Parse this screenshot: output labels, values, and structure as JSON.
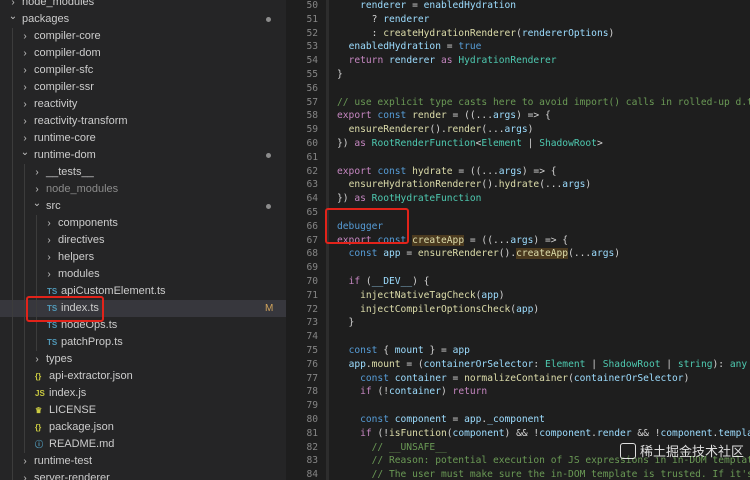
{
  "sidebar": {
    "items": [
      {
        "label": "node_modules",
        "kind": "folder",
        "depth": 0,
        "open": false,
        "dot": false
      },
      {
        "label": "packages",
        "kind": "folder",
        "depth": 0,
        "open": true,
        "dot": true
      },
      {
        "label": "compiler-core",
        "kind": "folder",
        "depth": 1,
        "open": false,
        "dot": false
      },
      {
        "label": "compiler-dom",
        "kind": "folder",
        "depth": 1,
        "open": false,
        "dot": false
      },
      {
        "label": "compiler-sfc",
        "kind": "folder",
        "depth": 1,
        "open": false,
        "dot": false
      },
      {
        "label": "compiler-ssr",
        "kind": "folder",
        "depth": 1,
        "open": false,
        "dot": false
      },
      {
        "label": "reactivity",
        "kind": "folder",
        "depth": 1,
        "open": false,
        "dot": false
      },
      {
        "label": "reactivity-transform",
        "kind": "folder",
        "depth": 1,
        "open": false,
        "dot": false
      },
      {
        "label": "runtime-core",
        "kind": "folder",
        "depth": 1,
        "open": false,
        "dot": false
      },
      {
        "label": "runtime-dom",
        "kind": "folder",
        "depth": 1,
        "open": true,
        "dot": true
      },
      {
        "label": "__tests__",
        "kind": "folder",
        "depth": 2,
        "open": false,
        "dot": false
      },
      {
        "label": "node_modules",
        "kind": "folder",
        "depth": 2,
        "open": false,
        "dot": false,
        "dim": true
      },
      {
        "label": "src",
        "kind": "folder",
        "depth": 2,
        "open": true,
        "dot": true
      },
      {
        "label": "components",
        "kind": "folder",
        "depth": 3,
        "open": false,
        "dot": false
      },
      {
        "label": "directives",
        "kind": "folder",
        "depth": 3,
        "open": false,
        "dot": false
      },
      {
        "label": "helpers",
        "kind": "folder",
        "depth": 3,
        "open": false,
        "dot": false
      },
      {
        "label": "modules",
        "kind": "folder",
        "depth": 3,
        "open": false,
        "dot": false
      },
      {
        "label": "apiCustomElement.ts",
        "kind": "ts",
        "depth": 3,
        "dot": false
      },
      {
        "label": "index.ts",
        "kind": "ts",
        "depth": 3,
        "dot": false,
        "modified": "M",
        "selected": true
      },
      {
        "label": "nodeOps.ts",
        "kind": "ts",
        "depth": 3,
        "dot": false
      },
      {
        "label": "patchProp.ts",
        "kind": "ts",
        "depth": 3,
        "dot": false
      },
      {
        "label": "types",
        "kind": "folder",
        "depth": 2,
        "open": false,
        "dot": false
      },
      {
        "label": "api-extractor.json",
        "kind": "json",
        "depth": 2,
        "dot": false
      },
      {
        "label": "index.js",
        "kind": "js",
        "depth": 2,
        "dot": false
      },
      {
        "label": "LICENSE",
        "kind": "license",
        "depth": 2,
        "dot": false
      },
      {
        "label": "package.json",
        "kind": "json",
        "depth": 2,
        "dot": false
      },
      {
        "label": "README.md",
        "kind": "md",
        "depth": 2,
        "dot": false
      },
      {
        "label": "runtime-test",
        "kind": "folder",
        "depth": 1,
        "open": false,
        "dot": false
      },
      {
        "label": "server-renderer",
        "kind": "folder",
        "depth": 1,
        "open": false,
        "dot": false
      }
    ]
  },
  "icons": {
    "ts": "TS",
    "json": "{}",
    "js": "JS",
    "license": "♛",
    "md": "ⓘ"
  },
  "colors": {
    "ts": "#519aba",
    "json": "#cbcb41",
    "js": "#cbcb41",
    "license": "#cbcb41",
    "md": "#519aba",
    "accent": "#e2231a"
  },
  "editor": {
    "lines": [
      {
        "n": "50",
        "tokens": [
          [
            "    ",
            "p"
          ],
          [
            "renderer",
            "v"
          ],
          [
            " = ",
            "p"
          ],
          [
            "enabledHydration",
            "v"
          ]
        ]
      },
      {
        "n": "51",
        "tokens": [
          [
            "      ? ",
            "p"
          ],
          [
            "renderer",
            "v"
          ]
        ]
      },
      {
        "n": "52",
        "tokens": [
          [
            "      : ",
            "p"
          ],
          [
            "createHydrationRenderer",
            "fn"
          ],
          [
            "(",
            "p"
          ],
          [
            "rendererOptions",
            "v"
          ],
          [
            ")",
            "p"
          ]
        ]
      },
      {
        "n": "53",
        "tokens": [
          [
            "  ",
            "p"
          ],
          [
            "enabledHydration",
            "v"
          ],
          [
            " = ",
            "p"
          ],
          [
            "true",
            "k"
          ]
        ]
      },
      {
        "n": "54",
        "tokens": [
          [
            "  ",
            "p"
          ],
          [
            "return",
            "kc"
          ],
          [
            " ",
            "p"
          ],
          [
            "renderer",
            "v"
          ],
          [
            " ",
            "p"
          ],
          [
            "as",
            "kc"
          ],
          [
            " ",
            "p"
          ],
          [
            "HydrationRenderer",
            "ty"
          ]
        ]
      },
      {
        "n": "55",
        "tokens": [
          [
            "}",
            "p"
          ]
        ]
      },
      {
        "n": "56",
        "tokens": []
      },
      {
        "n": "57",
        "tokens": [
          [
            "// use explicit type casts here to avoid import() calls in rolled-up d.ts",
            "cm"
          ]
        ]
      },
      {
        "n": "58",
        "tokens": [
          [
            "export",
            "kc"
          ],
          [
            " ",
            "p"
          ],
          [
            "const",
            "k"
          ],
          [
            " ",
            "p"
          ],
          [
            "render",
            "fn"
          ],
          [
            " = ((...",
            "p"
          ],
          [
            "args",
            "v"
          ],
          [
            ") => {",
            "p"
          ]
        ]
      },
      {
        "n": "59",
        "tokens": [
          [
            "  ",
            "p"
          ],
          [
            "ensureRenderer",
            "fn"
          ],
          [
            "().",
            "p"
          ],
          [
            "render",
            "fn"
          ],
          [
            "(...",
            "p"
          ],
          [
            "args",
            "v"
          ],
          [
            ")",
            "p"
          ]
        ]
      },
      {
        "n": "60",
        "tokens": [
          [
            "}) ",
            "p"
          ],
          [
            "as",
            "kc"
          ],
          [
            " ",
            "p"
          ],
          [
            "RootRenderFunction",
            "ty"
          ],
          [
            "<",
            "p"
          ],
          [
            "Element",
            "ty"
          ],
          [
            " | ",
            "p"
          ],
          [
            "ShadowRoot",
            "ty"
          ],
          [
            ">",
            "p"
          ]
        ]
      },
      {
        "n": "61",
        "tokens": []
      },
      {
        "n": "62",
        "tokens": [
          [
            "export",
            "kc"
          ],
          [
            " ",
            "p"
          ],
          [
            "const",
            "k"
          ],
          [
            " ",
            "p"
          ],
          [
            "hydrate",
            "fn"
          ],
          [
            " = ((...",
            "p"
          ],
          [
            "args",
            "v"
          ],
          [
            ") => {",
            "p"
          ]
        ]
      },
      {
        "n": "63",
        "tokens": [
          [
            "  ",
            "p"
          ],
          [
            "ensureHydrationRenderer",
            "fn"
          ],
          [
            "().",
            "p"
          ],
          [
            "hydrate",
            "fn"
          ],
          [
            "(...",
            "p"
          ],
          [
            "args",
            "v"
          ],
          [
            ")",
            "p"
          ]
        ]
      },
      {
        "n": "64",
        "tokens": [
          [
            "}) ",
            "p"
          ],
          [
            "as",
            "kc"
          ],
          [
            " ",
            "p"
          ],
          [
            "RootHydrateFunction",
            "ty"
          ]
        ]
      },
      {
        "n": "65",
        "tokens": []
      },
      {
        "n": "66",
        "tokens": [
          [
            "debugger",
            "k"
          ]
        ]
      },
      {
        "n": "67",
        "tokens": [
          [
            "export",
            "kc"
          ],
          [
            " ",
            "p"
          ],
          [
            "const",
            "k"
          ],
          [
            " ",
            "p"
          ],
          [
            "createApp",
            "fn hl"
          ],
          [
            " = ((...",
            "p"
          ],
          [
            "args",
            "v"
          ],
          [
            ") => {",
            "p"
          ]
        ]
      },
      {
        "n": "68",
        "tokens": [
          [
            "  ",
            "p"
          ],
          [
            "const",
            "k"
          ],
          [
            " ",
            "p"
          ],
          [
            "app",
            "v"
          ],
          [
            " = ",
            "p"
          ],
          [
            "ensureRenderer",
            "fn"
          ],
          [
            "().",
            "p"
          ],
          [
            "createApp",
            "fn hl"
          ],
          [
            "(...",
            "p"
          ],
          [
            "args",
            "v"
          ],
          [
            ")",
            "p"
          ]
        ]
      },
      {
        "n": "69",
        "tokens": []
      },
      {
        "n": "70",
        "tokens": [
          [
            "  ",
            "p"
          ],
          [
            "if",
            "kc"
          ],
          [
            " (",
            "p"
          ],
          [
            "__DEV__",
            "v"
          ],
          [
            ") {",
            "p"
          ]
        ]
      },
      {
        "n": "71",
        "tokens": [
          [
            "    ",
            "p"
          ],
          [
            "injectNativeTagCheck",
            "fn"
          ],
          [
            "(",
            "p"
          ],
          [
            "app",
            "v"
          ],
          [
            ")",
            "p"
          ]
        ]
      },
      {
        "n": "72",
        "tokens": [
          [
            "    ",
            "p"
          ],
          [
            "injectCompilerOptionsCheck",
            "fn"
          ],
          [
            "(",
            "p"
          ],
          [
            "app",
            "v"
          ],
          [
            ")",
            "p"
          ]
        ]
      },
      {
        "n": "73",
        "tokens": [
          [
            "  }",
            "p"
          ]
        ]
      },
      {
        "n": "74",
        "tokens": []
      },
      {
        "n": "75",
        "tokens": [
          [
            "  ",
            "p"
          ],
          [
            "const",
            "k"
          ],
          [
            " { ",
            "p"
          ],
          [
            "mount",
            "v"
          ],
          [
            " } = ",
            "p"
          ],
          [
            "app",
            "v"
          ]
        ]
      },
      {
        "n": "76",
        "tokens": [
          [
            "  ",
            "p"
          ],
          [
            "app",
            "v"
          ],
          [
            ".",
            "p"
          ],
          [
            "mount",
            "fn"
          ],
          [
            " = (",
            "p"
          ],
          [
            "containerOrSelector",
            "v"
          ],
          [
            ": ",
            "p"
          ],
          [
            "Element",
            "ty"
          ],
          [
            " | ",
            "p"
          ],
          [
            "ShadowRoot",
            "ty"
          ],
          [
            " | ",
            "p"
          ],
          [
            "string",
            "ty"
          ],
          [
            "): ",
            "p"
          ],
          [
            "any",
            "ty"
          ],
          [
            " =>",
            "p"
          ]
        ]
      },
      {
        "n": "77",
        "tokens": [
          [
            "    ",
            "p"
          ],
          [
            "const",
            "k"
          ],
          [
            " ",
            "p"
          ],
          [
            "container",
            "v"
          ],
          [
            " = ",
            "p"
          ],
          [
            "normalizeContainer",
            "fn"
          ],
          [
            "(",
            "p"
          ],
          [
            "containerOrSelector",
            "v"
          ],
          [
            ")",
            "p"
          ]
        ]
      },
      {
        "n": "78",
        "tokens": [
          [
            "    ",
            "p"
          ],
          [
            "if",
            "kc"
          ],
          [
            " (!",
            "p"
          ],
          [
            "container",
            "v"
          ],
          [
            ") ",
            "p"
          ],
          [
            "return",
            "kc"
          ]
        ]
      },
      {
        "n": "79",
        "tokens": []
      },
      {
        "n": "80",
        "tokens": [
          [
            "    ",
            "p"
          ],
          [
            "const",
            "k"
          ],
          [
            " ",
            "p"
          ],
          [
            "component",
            "v"
          ],
          [
            " = ",
            "p"
          ],
          [
            "app",
            "v"
          ],
          [
            ".",
            "p"
          ],
          [
            "_component",
            "v"
          ]
        ]
      },
      {
        "n": "81",
        "tokens": [
          [
            "    ",
            "p"
          ],
          [
            "if",
            "kc"
          ],
          [
            " (!",
            "p"
          ],
          [
            "isFunction",
            "fn"
          ],
          [
            "(",
            "p"
          ],
          [
            "component",
            "v"
          ],
          [
            ") && !",
            "p"
          ],
          [
            "component",
            "v"
          ],
          [
            ".",
            "p"
          ],
          [
            "render",
            "v"
          ],
          [
            " && !",
            "p"
          ],
          [
            "component",
            "v"
          ],
          [
            ".",
            "p"
          ],
          [
            "template",
            "v"
          ]
        ]
      },
      {
        "n": "82",
        "tokens": [
          [
            "      // __UNSAFE__",
            "cm"
          ]
        ]
      },
      {
        "n": "83",
        "tokens": [
          [
            "      // Reason: potential execution of JS expressions in in-DOM template.",
            "cm"
          ]
        ]
      },
      {
        "n": "84",
        "tokens": [
          [
            "      // The user must make sure the in-DOM template is trusted. If it's",
            "cm"
          ]
        ]
      }
    ]
  },
  "watermark": {
    "text": "稀土掘金技术社区"
  }
}
